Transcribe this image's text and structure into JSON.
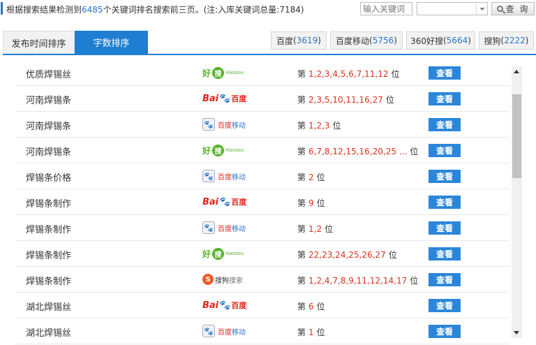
{
  "summary": {
    "prefix": "根据搜索结果检测到",
    "count": "6485",
    "suffix": "个关键词排名搜索前三页。(注:入库关键词总量:7184)"
  },
  "search": {
    "placeholder": "输入关键词",
    "button_label": "查 询"
  },
  "tabs": [
    {
      "label": "发布时间排序",
      "active": false
    },
    {
      "label": "字数排序",
      "active": true
    }
  ],
  "engines": [
    {
      "name": "百度",
      "count": "3619"
    },
    {
      "name": "百度移动",
      "count": "5756"
    },
    {
      "name": "360好搜",
      "count": "5664"
    },
    {
      "name": "搜狗",
      "count": "2222"
    }
  ],
  "logos": {
    "haosou": {
      "hao": "好",
      "sou": "搜",
      "en": "Haosou"
    },
    "baidu": {
      "t1": "Bai",
      "paw": "🐾",
      "t2": "百度"
    },
    "baidu_mobile": {
      "icon": "🐾",
      "t1": "百度",
      "t2": "移动"
    },
    "sogou": {
      "s": "S",
      "t1": "搜狗",
      "t2": "搜索"
    }
  },
  "rank_prefix": "第",
  "rank_suffix": "位",
  "view_label": "查看",
  "rows": [
    {
      "keyword": "优质焊锡丝",
      "engine": "haosou",
      "positions": "1,2,3,4,5,6,7,11,12"
    },
    {
      "keyword": "河南焊锡条",
      "engine": "baidu",
      "positions": "2,3,5,10,11,16,27"
    },
    {
      "keyword": "河南焊锡条",
      "engine": "baidu_mobile",
      "positions": "1,2,3"
    },
    {
      "keyword": "河南焊锡条",
      "engine": "haosou",
      "positions": "6,7,8,12,15,16,20,25 ..."
    },
    {
      "keyword": "焊锡条价格",
      "engine": "baidu_mobile",
      "positions": "2"
    },
    {
      "keyword": "焊锡条制作",
      "engine": "baidu",
      "positions": "9"
    },
    {
      "keyword": "焊锡条制作",
      "engine": "baidu_mobile",
      "positions": "1,2"
    },
    {
      "keyword": "焊锡条制作",
      "engine": "haosou",
      "positions": "22,23,24,25,26,27"
    },
    {
      "keyword": "焊锡条制作",
      "engine": "sogou",
      "positions": "1,2,4,7,8,9,11,12,14,17"
    },
    {
      "keyword": "湖北焊锡丝",
      "engine": "baidu",
      "positions": "6"
    },
    {
      "keyword": "湖北焊锡丝",
      "engine": "baidu_mobile",
      "positions": "1"
    }
  ]
}
